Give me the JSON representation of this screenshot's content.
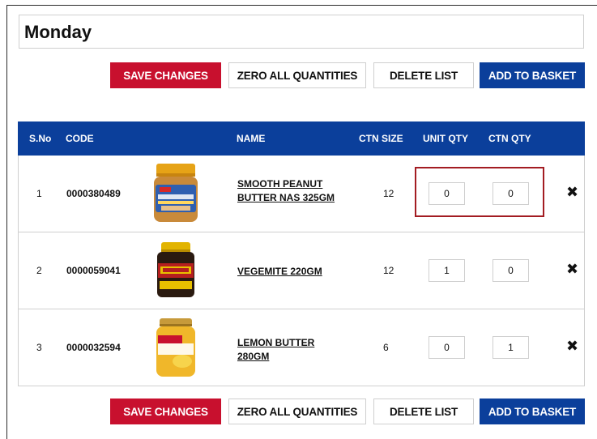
{
  "list": {
    "title": "Monday"
  },
  "actions": {
    "save": "SAVE CHANGES",
    "zero": "ZERO ALL QUANTITIES",
    "delete": "DELETE LIST",
    "add": "ADD TO BASKET"
  },
  "columns": {
    "sno": "S.No",
    "code": "CODE",
    "name": "NAME",
    "ctn_size": "CTN SIZE",
    "unit_qty": "UNIT QTY",
    "ctn_qty": "CTN QTY"
  },
  "rows": [
    {
      "sno": "1",
      "code": "0000380489",
      "name": "SMOOTH PEANUT BUTTER NAS 325GM",
      "ctn_size": "12",
      "unit_qty": "0",
      "ctn_qty": "0",
      "image": "peanut-butter-jar"
    },
    {
      "sno": "2",
      "code": "0000059041",
      "name": "VEGEMITE 220GM",
      "ctn_size": "12",
      "unit_qty": "1",
      "ctn_qty": "0",
      "image": "vegemite-jar"
    },
    {
      "sno": "3",
      "code": "0000032594",
      "name": "LEMON BUTTER 280GM",
      "ctn_size": "6",
      "unit_qty": "0",
      "ctn_qty": "1",
      "image": "lemon-butter-jar"
    }
  ],
  "icons": {
    "delete_row": "close-x-icon"
  },
  "colors": {
    "primary_blue": "#0b3f9b",
    "save_red": "#c8102e",
    "highlight": "#a31c22"
  }
}
